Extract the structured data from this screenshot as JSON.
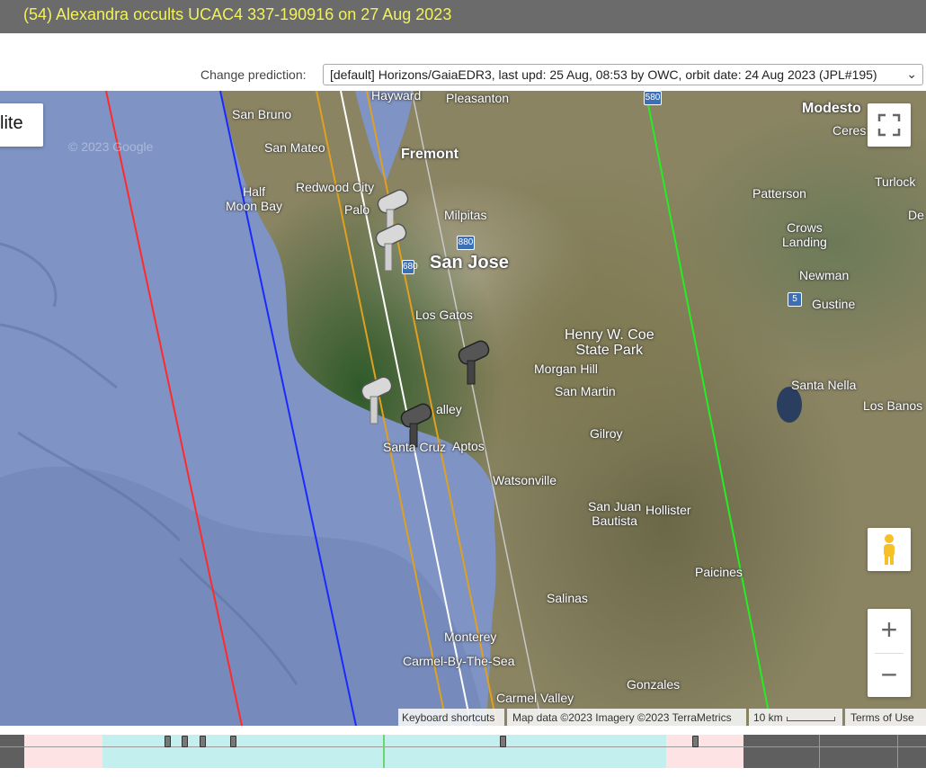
{
  "title": "(54) Alexandra occults UCAC4 337-190916 on 27 Aug 2023",
  "prediction": {
    "label": "Change prediction:",
    "selected": "[default] Horizons/GaiaEDR3, last upd: 25 Aug, 08:53 by OWC, orbit date: 24 Aug 2023 (JPL#195)"
  },
  "map": {
    "map_type_button": "lite",
    "watermark": "© 2023 Google",
    "places": {
      "hayward": "Hayward",
      "pleasanton": "Pleasanton",
      "san_bruno": "San Bruno",
      "modesto": "Modesto",
      "ceres": "Ceres",
      "san_mateo": "San Mateo",
      "fremont": "Fremont",
      "redwood_city": "Redwood City",
      "patterson": "Patterson",
      "turlock": "Turlock",
      "half_moon_bay": "Half\nMoon Bay",
      "palo": "Palo",
      "milpitas": "Milpitas",
      "crows_landing": "Crows\nLanding",
      "san_jose": "San Jose",
      "newman": "Newman",
      "gustine": "Gustine",
      "los_gatos": "Los Gatos",
      "henry_coe": "Henry W. Coe\nState Park",
      "morgan_hill": "Morgan Hill",
      "santa_nella": "Santa Nella",
      "san_martin": "San Martin",
      "los_banos": "Los Banos",
      "valley": "alley",
      "gilroy": "Gilroy",
      "santa_cruz": "Santa Cruz",
      "aptos": "Aptos",
      "watsonville": "Watsonville",
      "san_juan_bautista": "San Juan\nBautista",
      "hollister": "Hollister",
      "paicines": "Paicines",
      "salinas": "Salinas",
      "monterey": "Monterey",
      "carmel_by_the_sea": "Carmel-By-The-Sea",
      "gonzales": "Gonzales",
      "carmel_valley": "Carmel Valley",
      "de": "De"
    },
    "highways": {
      "h580": "580",
      "h880": "880",
      "h680": "680",
      "h5": "5"
    },
    "attribution": {
      "keyboard": "Keyboard shortcuts",
      "mapdata": "Map data ©2023 Imagery ©2023 TerraMetrics",
      "scale": "10 km",
      "terms": "Terms of Use"
    },
    "zoom_in": "+",
    "zoom_out": "−"
  },
  "path_colors": {
    "red": "#ff2a2a",
    "blue": "#1a2aff",
    "orange": "#e0a020",
    "white": "#ffffff",
    "gray": "#c8c8c8",
    "green": "#22ee22"
  },
  "colors": {
    "title_bg": "#6b6b6b",
    "title_text": "#f2f25a",
    "timeline_pink": "#fde3e3",
    "timeline_cyan": "#c3f0ee"
  }
}
